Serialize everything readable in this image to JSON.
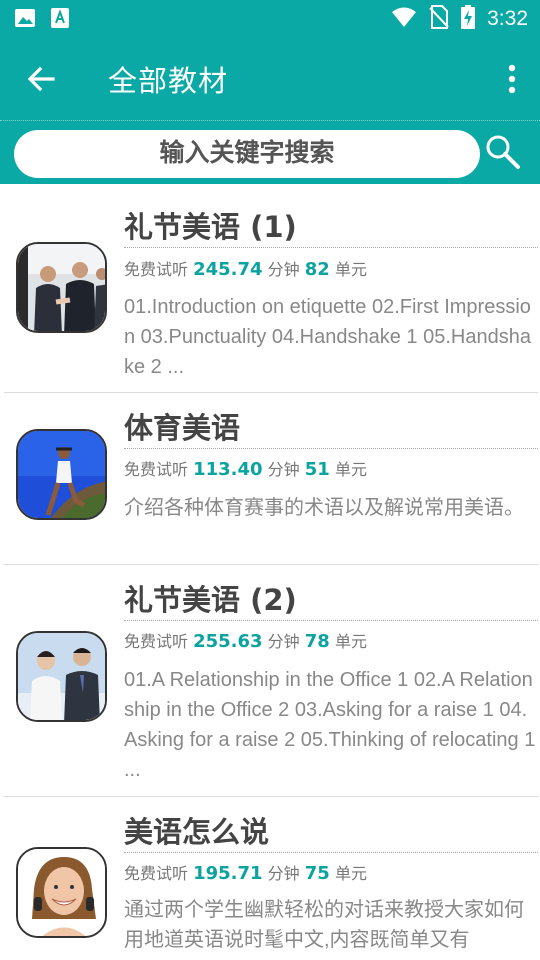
{
  "status_bar": {
    "time": "3:32",
    "icons": [
      "gallery-icon",
      "text-app-icon",
      "wifi-icon",
      "no-sim-icon",
      "battery-charging-icon"
    ]
  },
  "app_bar": {
    "title": "全部教材",
    "back_icon": "back-arrow-icon",
    "menu_icon": "more-vert-icon"
  },
  "search": {
    "placeholder": "输入关键字搜索",
    "icon": "search-icon"
  },
  "colors": {
    "primary": "#0aa9a5",
    "number": "#0aa3a0",
    "title_text": "#444444",
    "desc_text": "#888888"
  },
  "courses": [
    {
      "title": "礼节美语 (1)",
      "trial_prefix": "免费试听",
      "minutes": "245.74",
      "minutes_unit": "分钟",
      "units": "82",
      "units_label": "单元",
      "description": "01.Introduction on etiquette 02.First Impression 03.Punctuality 04.Handshake 1 05.Handshake 2 ..."
    },
    {
      "title": "体育美语",
      "trial_prefix": "免费试听",
      "minutes": "113.40",
      "minutes_unit": "分钟",
      "units": "51",
      "units_label": "单元",
      "description": "介绍各种体育赛事的术语以及解说常用美语。"
    },
    {
      "title": "礼节美语 (2)",
      "trial_prefix": "免费试听",
      "minutes": "255.63",
      "minutes_unit": "分钟",
      "units": "78",
      "units_label": "单元",
      "description": "01.A Relationship in the Office 1 02.A Relationship in the Office 2 03.Asking for a raise 1 04.Asking for a raise 2 05.Thinking of relocating 1 ..."
    },
    {
      "title": "美语怎么说",
      "trial_prefix": "免费试听",
      "minutes": "195.71",
      "minutes_unit": "分钟",
      "units": "75",
      "units_label": "单元",
      "description": "通过两个学生幽默轻松的对话来教授大家如何用地道英语说时髦中文,内容既简单又有"
    }
  ]
}
